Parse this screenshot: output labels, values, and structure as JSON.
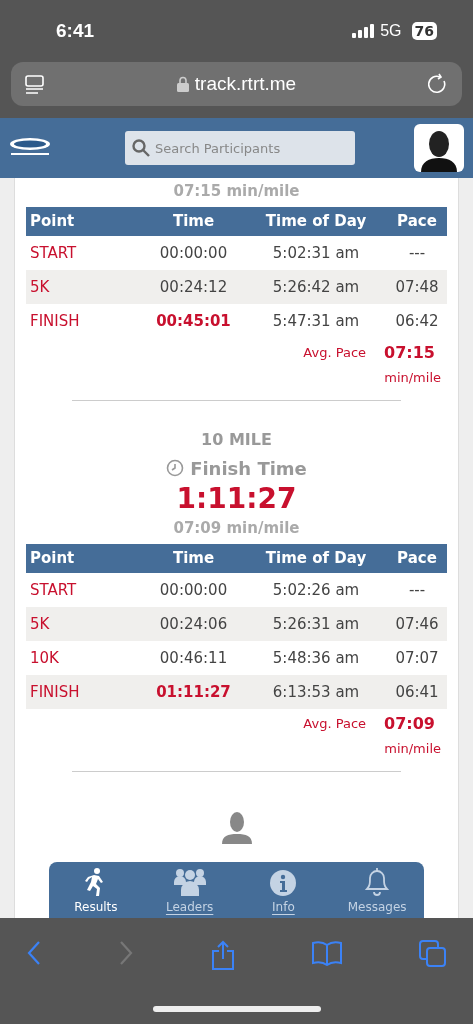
{
  "status_bar": {
    "time": "6:41",
    "network": "5G",
    "battery": "76"
  },
  "browser": {
    "url": "track.rtrt.me"
  },
  "header": {
    "search": {
      "placeholder": "Search Participants"
    }
  },
  "results": [
    {
      "pace_line": "07:15 min/mile",
      "table": {
        "columns": [
          "Point",
          "Time",
          "Time of Day",
          "Pace"
        ],
        "rows": [
          {
            "point": "START",
            "time": "00:00:00",
            "time_of_day": "5:02:31 am",
            "pace": "---",
            "final": false
          },
          {
            "point": "5K",
            "time": "00:24:12",
            "time_of_day": "5:26:42 am",
            "pace": "07:48",
            "final": false
          },
          {
            "point": "FINISH",
            "time": "00:45:01",
            "time_of_day": "5:47:31 am",
            "pace": "06:42",
            "final": true
          }
        ]
      },
      "avg_pace": {
        "label": "Avg. Pace",
        "value": "07:15",
        "unit": "min/mile"
      }
    },
    {
      "title": "10 MILE",
      "finish_label": "Finish Time",
      "finish_time": "1:11:27",
      "pace_line": "07:09 min/mile",
      "table": {
        "columns": [
          "Point",
          "Time",
          "Time of Day",
          "Pace"
        ],
        "rows": [
          {
            "point": "START",
            "time": "00:00:00",
            "time_of_day": "5:02:26 am",
            "pace": "---",
            "final": false
          },
          {
            "point": "5K",
            "time": "00:24:06",
            "time_of_day": "5:26:31 am",
            "pace": "07:46",
            "final": false
          },
          {
            "point": "10K",
            "time": "00:46:11",
            "time_of_day": "5:48:36 am",
            "pace": "07:07",
            "final": false
          },
          {
            "point": "FINISH",
            "time": "01:11:27",
            "time_of_day": "6:13:53 am",
            "pace": "06:41",
            "final": true
          }
        ]
      },
      "avg_pace": {
        "label": "Avg. Pace",
        "value": "07:09",
        "unit": "min/mile"
      }
    }
  ],
  "tabs": [
    {
      "label": "Results",
      "selected": true,
      "link": false
    },
    {
      "label": "Leaders",
      "selected": false,
      "link": true
    },
    {
      "label": "Info",
      "selected": false,
      "link": true
    },
    {
      "label": "Messages",
      "selected": false,
      "link": false
    }
  ]
}
